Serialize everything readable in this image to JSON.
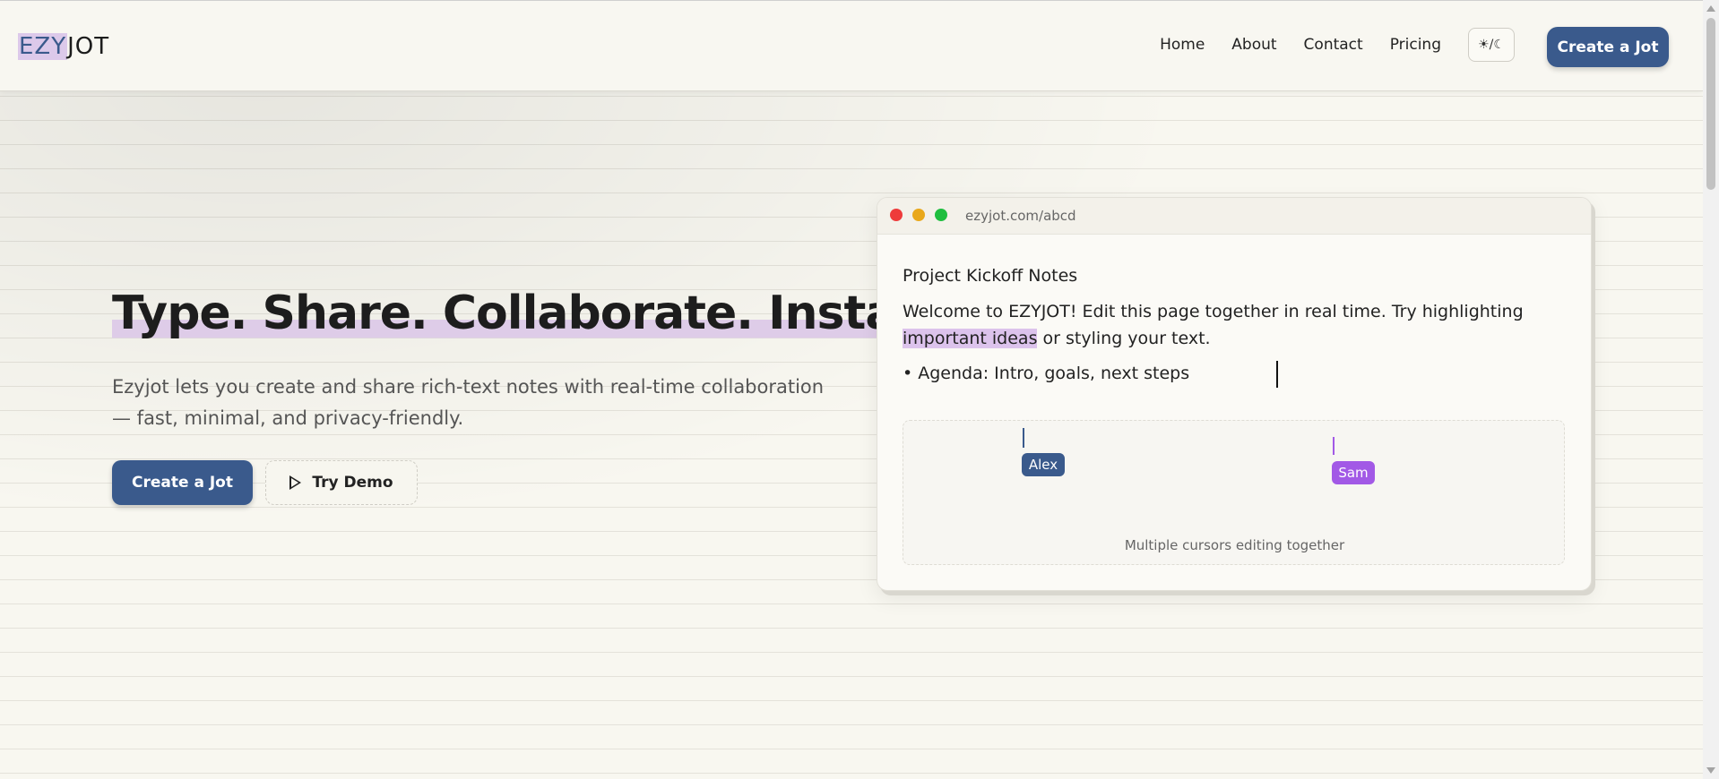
{
  "header": {
    "logo_highlight": "EZY",
    "logo_rest": "JOT",
    "nav": [
      "Home",
      "About",
      "Contact",
      "Pricing"
    ],
    "theme_toggle_label": "☀/☾",
    "cta_label": "Create a Jot"
  },
  "hero": {
    "title": "Type. Share. Collaborate. Instantly.",
    "subtitle": "Ezyjot lets you create and share rich-text notes with real-time collaboration — fast, minimal, and privacy-friendly.",
    "primary_cta": "Create a Jot",
    "secondary_cta": "Try Demo"
  },
  "editor_preview": {
    "url": "ezyjot.com/abcd",
    "note_title": "Project Kickoff Notes",
    "body_before": "Welcome to EZYJOT! Edit this page together in real time. Try highlighting ",
    "body_highlight": "important ideas",
    "body_after": " or styling your text.",
    "agenda": "• Agenda: Intro, goals, next steps",
    "collaborators": [
      "Alex",
      "Sam"
    ],
    "caption": "Multiple cursors editing together"
  },
  "colors": {
    "brand": "#3a5a8c",
    "highlight": "#dcc3ec",
    "collaborator_sam": "#a259e6"
  }
}
